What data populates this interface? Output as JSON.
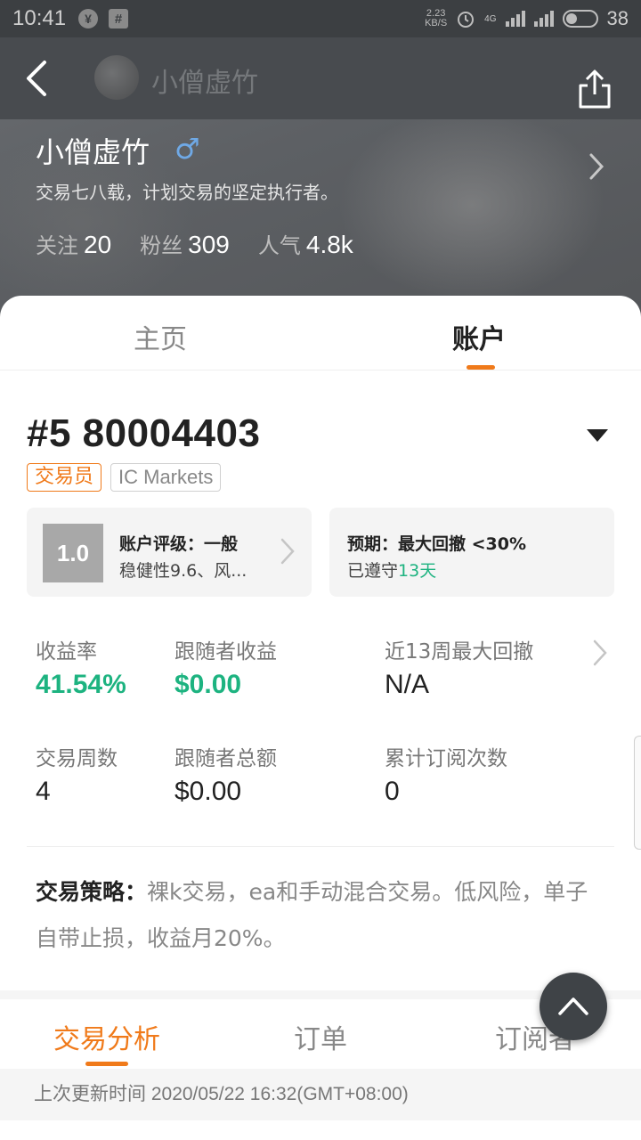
{
  "status_bar": {
    "time": "10:41",
    "net_speed_value": "2.23",
    "net_speed_unit": "KB/S",
    "network_type": "4G",
    "battery": "38"
  },
  "nav": {
    "title": "小僧虚竹"
  },
  "profile": {
    "name": "小僧虚竹",
    "gender_symbol": "♂",
    "bio": "交易七八载，计划交易的坚定执行者。",
    "following_label": "关注",
    "following_value": "20",
    "followers_label": "粉丝",
    "followers_value": "309",
    "popularity_label": "人气",
    "popularity_value": "4.8k"
  },
  "tabs": {
    "home": "主页",
    "account": "账户",
    "active": "account"
  },
  "account": {
    "number": "#5 80004403",
    "role_tag": "交易员",
    "broker_tag": "IC Markets"
  },
  "rating_card": {
    "score": "1.0",
    "title": "账户评级：一般",
    "detail": "稳健性9.6、风..."
  },
  "expect_card": {
    "title": "预期：最大回撤 <30%",
    "compliance_prefix": "已遵守",
    "compliance_days": "13天"
  },
  "metrics": {
    "return_label": "收益率",
    "return_value": "41.54%",
    "follower_profit_label": "跟随者收益",
    "follower_profit_value": "$0.00",
    "max_drawdown_label": "近13周最大回撤",
    "max_drawdown_value": "N/A",
    "trading_weeks_label": "交易周数",
    "trading_weeks_value": "4",
    "follower_total_label": "跟随者总额",
    "follower_total_value": "$0.00",
    "subscriptions_label": "累计订阅次数",
    "subscriptions_value": "0"
  },
  "strategy": {
    "label": "交易策略：",
    "text": "裸k交易，ea和手动混合交易。低风险，单子自带止损，收益月20%。"
  },
  "sub_tabs": {
    "analysis": "交易分析",
    "orders": "订单",
    "subscribers": "订阅者",
    "active": "analysis"
  },
  "update": {
    "text": "上次更新时间 2020/05/22 16:32(GMT+08:00)"
  },
  "colors": {
    "accent": "#f07a1a",
    "positive": "#1db380",
    "gender": "#6fa9e6"
  }
}
